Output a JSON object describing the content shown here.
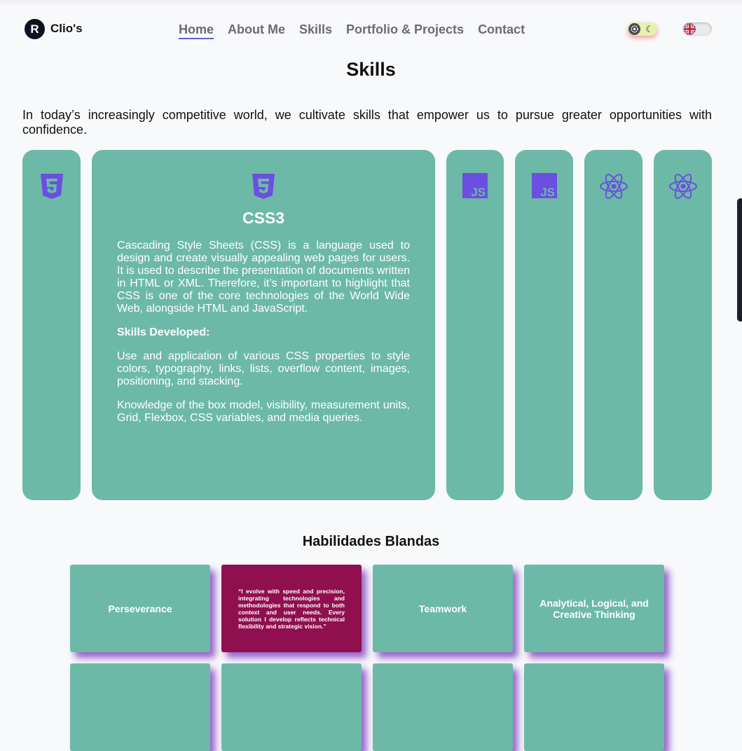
{
  "header": {
    "logo_letter": "R",
    "logo_text": "Clio's",
    "nav": [
      "Home",
      "About Me",
      "Skills",
      "Portfolio & Projects",
      "Contact"
    ],
    "active_nav": "Home",
    "theme_toggle_icons": [
      "gear-icon",
      "moon-icon"
    ],
    "language_flag": "uk-flag-icon"
  },
  "skills": {
    "title": "Skills",
    "intro": "In today’s increasingly competitive world, we cultivate skills that empower us to pursue greater opportunities with confidence.",
    "cards": [
      {
        "icon": "html5-icon"
      },
      {
        "icon": "css3-icon",
        "title": "CSS3",
        "description": "Cascading Style Sheets (CSS) is a language used to design and create visually appealing web pages for users. It is used to describe the presentation of documents written in HTML or XML. Therefore, it’s important to highlight that CSS is one of the core technologies of the World Wide Web, alongside HTML and JavaScript.",
        "subtitle": "Skills Developed:",
        "points": [
          "Use and application of various CSS properties to style colors, typography, links, lists, overflow content, images, positioning, and stacking.",
          "Knowledge of the box model, visibility, measurement units, Grid, Flexbox, CSS variables, and media queries."
        ]
      },
      {
        "icon": "javascript-icon"
      },
      {
        "icon": "javascript-icon"
      },
      {
        "icon": "react-icon"
      },
      {
        "icon": "react-icon"
      }
    ]
  },
  "soft_skills": {
    "title": "Habilidades Blandas",
    "tiles": [
      "Perseverance",
      "“I evolve with speed and precision, integrating technologies and methodologies that respond to both context and user needs. Every solution I develop reflects technical flexibility and strategic vision.”",
      "Teamwork",
      "Analytical, Logical, and Creative Thinking"
    ]
  },
  "colors": {
    "card": "#6db9a8",
    "icon": "#6b4fe0",
    "quote_tile": "#900f4e",
    "tile_shadow": "#762db9",
    "nav_underline": "#6b5bd3"
  }
}
